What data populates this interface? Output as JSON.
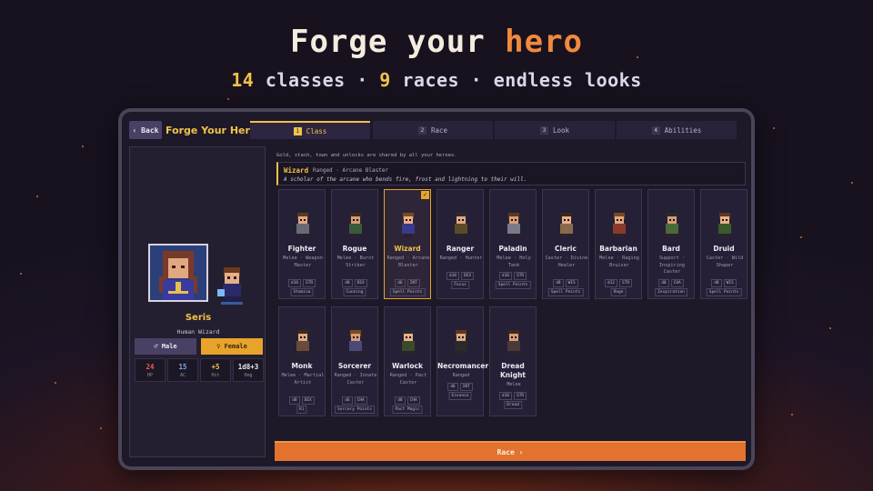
{
  "headline": {
    "prefix": "Forge your ",
    "accent": "hero"
  },
  "subline": {
    "classes_count": "14",
    "classes_text": " classes · ",
    "races_count": "9",
    "races_text": " races · endless looks"
  },
  "app": {
    "back_label": "‹ Back",
    "title": "Forge Your Hero",
    "tabs": [
      {
        "num": "1",
        "label": "Class",
        "active": true
      },
      {
        "num": "2",
        "label": "Race",
        "active": false
      },
      {
        "num": "3",
        "label": "Look",
        "active": false
      },
      {
        "num": "4",
        "label": "Abilities",
        "active": false
      }
    ]
  },
  "hero": {
    "name": "Seris",
    "subtitle": "Human Wizard",
    "male_label": "♂ Male",
    "female_label": "♀ Female",
    "stats": [
      {
        "value": "24",
        "label": "HP",
        "color": "#e8604c"
      },
      {
        "value": "15",
        "label": "AC",
        "color": "#7aa8e8"
      },
      {
        "value": "+5",
        "label": "Hit",
        "color": "#f2c24a"
      },
      {
        "value": "1d8+3",
        "label": "Dmg",
        "color": "#ecebf3"
      }
    ]
  },
  "notice": "Gold, stash, town and unlocks are shared by all your heroes.",
  "selected_class": {
    "name": "Wizard",
    "role": "Ranged · Arcane Blaster",
    "description": "A scholar of the arcane who bends fire, frost and lightning to their will."
  },
  "classes": [
    {
      "name": "Fighter",
      "role": "Melee · Weapon Master",
      "dice": "d10",
      "stat": "STR",
      "resource": "Stamina"
    },
    {
      "name": "Rogue",
      "role": "Melee · Burst Striker",
      "dice": "d8",
      "stat": "DEX",
      "resource": "Cunning"
    },
    {
      "name": "Wizard",
      "role": "Ranged · Arcane Blaster",
      "dice": "d6",
      "stat": "INT",
      "resource": "Spell Points",
      "selected": true
    },
    {
      "name": "Ranger",
      "role": "Ranged · Hunter",
      "dice": "d10",
      "stat": "DEX",
      "resource": "Focus"
    },
    {
      "name": "Paladin",
      "role": "Melee · Holy Tank",
      "dice": "d10",
      "stat": "STR",
      "resource": "Spell Points"
    },
    {
      "name": "Cleric",
      "role": "Caster · Divine Healer",
      "dice": "d8",
      "stat": "WIS",
      "resource": "Spell Points"
    },
    {
      "name": "Barbarian",
      "role": "Melee · Raging Bruiser",
      "dice": "d12",
      "stat": "STR",
      "resource": "Rage"
    },
    {
      "name": "Bard",
      "role": "Support · Inspiring Caster",
      "dice": "d8",
      "stat": "CHA",
      "resource": "Inspiration"
    },
    {
      "name": "Druid",
      "role": "Caster · Wild Shaper",
      "dice": "d8",
      "stat": "WIS",
      "resource": "Spell Points"
    },
    {
      "name": "Monk",
      "role": "Melee · Martial Artist",
      "dice": "d8",
      "stat": "DEX",
      "resource": "Ki"
    },
    {
      "name": "Sorcerer",
      "role": "Ranged · Innate Caster",
      "dice": "d6",
      "stat": "CHA",
      "resource": "Sorcery Points"
    },
    {
      "name": "Warlock",
      "role": "Ranged · Pact Caster",
      "dice": "d8",
      "stat": "CHA",
      "resource": "Pact Magic"
    },
    {
      "name": "Necromancer",
      "role": "Ranged",
      "dice": "d6",
      "stat": "INT",
      "resource": "Essence"
    },
    {
      "name": "Dread Knight",
      "role": "Melee",
      "dice": "d10",
      "stat": "STR",
      "resource": "Dread"
    }
  ],
  "race_button": "Race ›"
}
